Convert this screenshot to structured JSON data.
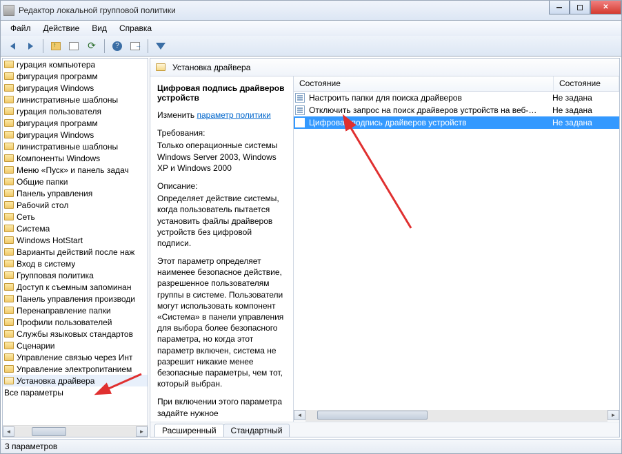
{
  "window": {
    "title": "Редактор локальной групповой политики"
  },
  "menu": {
    "file": "Файл",
    "action": "Действие",
    "view": "Вид",
    "help": "Справка"
  },
  "tree": {
    "items": [
      "гурация компьютера",
      "фигурация программ",
      "фигурация Windows",
      "линистративные шаблоны",
      "гурация пользователя",
      "фигурация программ",
      "фигурация Windows",
      "линистративные шаблоны",
      "Компоненты Windows",
      "Меню «Пуск» и панель задач",
      "Общие папки",
      "Панель управления",
      "Рабочий стол",
      "Сеть",
      "Система",
      "Windows HotStart",
      "Варианты действий после наж",
      "Вход в систему",
      "Групповая политика",
      "Доступ к съемным запоминан",
      "Панель управления производи",
      "Перенаправление папки",
      "Профили пользователей",
      "Службы языковых стандартов",
      "Сценарии",
      "Управление связью через Инт",
      "Управление электропитанием",
      "Установка драйвера",
      "Все параметры"
    ],
    "selected_index": 27,
    "plain_from_index": 28
  },
  "content": {
    "header": "Установка драйвера",
    "detail_title": "Цифровая подпись драйверов устройств",
    "edit_prefix": "Изменить ",
    "edit_link": "параметр политики",
    "req_label": "Требования:",
    "req_text": "Только операционные системы Windows Server 2003, Windows XP и Windows 2000",
    "desc_label": "Описание:",
    "desc_p1": "Определяет действие системы, когда пользователь пытается установить файлы драйверов устройств без цифровой подписи.",
    "desc_p2": "Этот параметр определяет наименее безопасное действие, разрешенное пользователям группы в системе. Пользователи могут использовать компонент «Система» в панели управления для выбора более безопасного параметра, но когда этот параметр включен, система не разрешит никакие менее безопасные параметры, чем тот, который выбран.",
    "desc_p3": "При включении этого параметра задайте нужное"
  },
  "list": {
    "col1": "Состояние",
    "col2": "Состояние",
    "rows": [
      {
        "name": "Настроить папки для поиска драйверов",
        "state": "Не задана"
      },
      {
        "name": "Отключить запрос на поиск драйверов устройств на веб-…",
        "state": "Не задана"
      },
      {
        "name": "Цифровая подпись драйверов устройств",
        "state": "Не задана"
      }
    ],
    "selected_index": 2
  },
  "tabs": {
    "tab1": "Расширенный",
    "tab2": "Стандартный"
  },
  "status": {
    "text": "3 параметров"
  }
}
